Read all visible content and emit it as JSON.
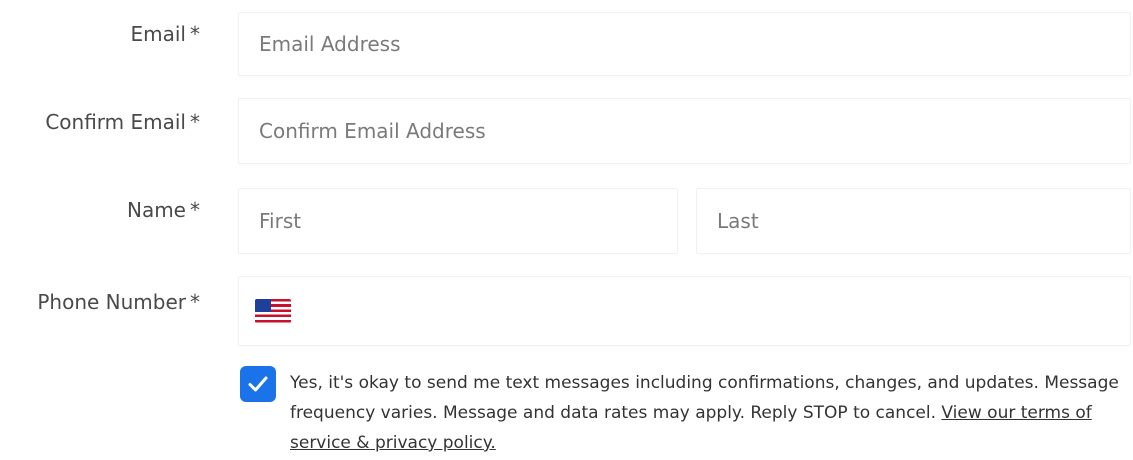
{
  "form": {
    "email": {
      "label": "Email",
      "required_mark": "*",
      "placeholder": "Email Address",
      "value": ""
    },
    "confirm_email": {
      "label": "Confirm Email",
      "required_mark": "*",
      "placeholder": "Confirm Email Address",
      "value": ""
    },
    "name": {
      "label": "Name",
      "required_mark": "*",
      "first_placeholder": "First",
      "last_placeholder": "Last",
      "first_value": "",
      "last_value": ""
    },
    "phone": {
      "label": "Phone Number",
      "required_mark": "*",
      "country_flag": "us-flag-icon",
      "value": ""
    },
    "consent": {
      "checked": true,
      "text": "Yes, it's okay to send me text messages including confirmations, changes, and updates. Message frequency varies. Message and data rates may apply. Reply STOP to cancel. ",
      "link_text": "View our terms of service & privacy policy."
    }
  },
  "colors": {
    "checkbox_fill": "#1a73e8",
    "label_text": "#4a4a4a",
    "placeholder_text": "#7a7a7a",
    "field_border": "#f0f1f3"
  }
}
